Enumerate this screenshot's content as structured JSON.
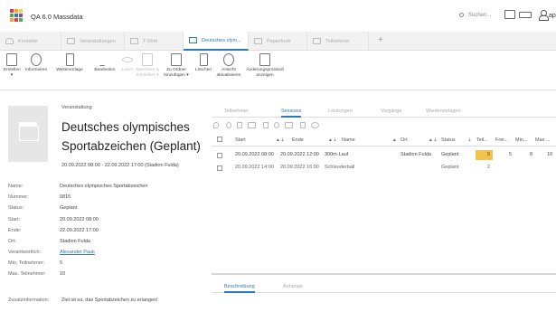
{
  "app": {
    "title": "QA 6.0 Massdata",
    "search_placeholder": "Suchen...",
    "user": "ap",
    "brand_colors": [
      "#e33b3b",
      "#f2a33c",
      "#f2d43c",
      "#4caf50",
      "#2a7ab8",
      "#8e44ad"
    ]
  },
  "tabs": [
    {
      "label": "Kontakte",
      "icon": "contacts-icon"
    },
    {
      "label": "Veranstaltungen",
      "icon": "grid-icon"
    },
    {
      "label": "T-Shirt",
      "icon": "shirt-icon"
    },
    {
      "label": "Deutsches olym...",
      "icon": "grid-icon",
      "active": true
    },
    {
      "label": "Papierkorb",
      "icon": "grid-icon"
    },
    {
      "label": "Teilnehmer",
      "icon": "grid-icon"
    }
  ],
  "ribbon": {
    "erstellen": "Erstellen",
    "informieren": "Informieren",
    "weitervorlage": "Weitervorlage",
    "bearbeiten": "Bearbeiten",
    "lesen": "Lesen",
    "speichern": "Speichern &",
    "schliessen": "Schließen",
    "zu_ordner": "Zu Ordner",
    "hinzufuegen": "hinzufügen",
    "loeschen": "Löschen",
    "ansicht": "Ansicht",
    "aktualisieren": "aktualisieren",
    "aenderungsprotokoll": "Änderungsprotokoll",
    "anzeigen": "anzeigen"
  },
  "event": {
    "kind": "Veranstaltung",
    "title": "Deutsches olympisches Sportabzeichen (Geplant)",
    "range": "20.09.2022 08:00 - 22.09.2022 17:00 (Stadion Fulda)"
  },
  "details": [
    {
      "key": "Name:",
      "value": "Deutsches olympisches Sportabzeichen"
    },
    {
      "key": "Nummer:",
      "value": "0815"
    },
    {
      "key": "Status:",
      "value": "Geplant"
    },
    {
      "key": "Start:",
      "value": "20.09.2022 08:00"
    },
    {
      "key": "Ende:",
      "value": "22.09.2022 17:00"
    },
    {
      "key": "Ort:",
      "value": "Stadion Fulda"
    },
    {
      "key": "Verantwortlich:",
      "value": "Alexander Pauk",
      "link": true
    },
    {
      "key": "Min. Teilnehmer:",
      "value": "5"
    },
    {
      "key": "Max. Teilnehmer:",
      "value": "10"
    },
    {
      "key": "Zusatzinformation:",
      "value": "Ziel ist es, das Sportabzeichen zu erlangen!"
    }
  ],
  "right_tabs": [
    "Teilnehmer",
    "Sessions",
    "Leistungen",
    "Vorgänge",
    "Wiedervorlagen"
  ],
  "grid": {
    "columns": [
      "Start",
      "Ende",
      "Name",
      "Ort",
      "Status",
      "Teil...",
      "Frei...",
      "Min...",
      "Max ..."
    ],
    "rows": [
      {
        "start": "20.09.2022 08:00",
        "ende": "20.09.2022 12:00",
        "name": "300m-Lauf",
        "ort": "Stadion Fulda",
        "status": "Geplant",
        "teil": "5",
        "frei": "5",
        "min": "8",
        "max": "10"
      },
      {
        "start": "20.09.2022 14:00",
        "ende": "20.09.2022 16:00",
        "name": "Schleuderball",
        "ort": "",
        "status": "Geplant",
        "teil": "2",
        "frei": "",
        "min": "",
        "max": ""
      }
    ],
    "highlight_color": "#f2c14e"
  },
  "bottom_tabs": [
    "Beschreibung",
    "Anhänge"
  ]
}
